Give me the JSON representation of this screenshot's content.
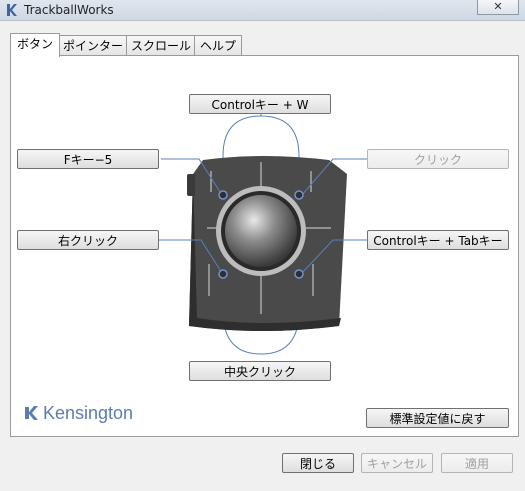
{
  "window": {
    "title": "TrackballWorks"
  },
  "tabs": [
    {
      "label": "ボタン",
      "active": true
    },
    {
      "label": "ポインター",
      "active": false
    },
    {
      "label": "スクロール",
      "active": false
    },
    {
      "label": "ヘルプ",
      "active": false
    }
  ],
  "buttons_panel": {
    "top": "Controlキー + W",
    "upper_left": "Fキー−5",
    "upper_right": "クリック",
    "lower_left": "右クリック",
    "lower_right": "Controlキー + Tabキー",
    "bottom": "中央クリック",
    "reset": "標準設定値に戻す"
  },
  "brand": {
    "name": "Kensington",
    "color": "#5c7db4"
  },
  "footer": {
    "close": "閉じる",
    "cancel": "キャンセル",
    "apply": "適用"
  }
}
